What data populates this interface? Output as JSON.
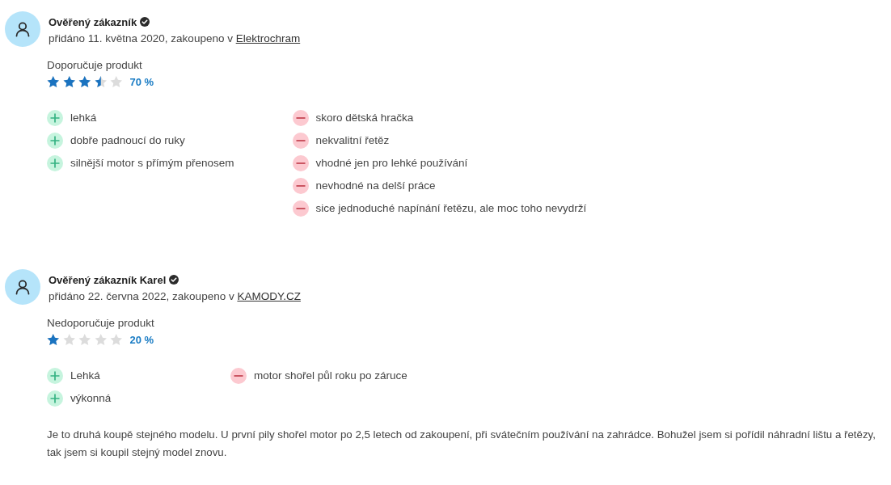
{
  "reviews": [
    {
      "author": "Ověřený zákazník",
      "verified": true,
      "purchase_info": "přidáno 11. května 2020, zakoupeno v",
      "shop": "Elektrochram",
      "recommendation": "Doporučuje produkt",
      "stars": 3.5,
      "rating": "70 %",
      "pros": [
        "lehká",
        "dobře padnoucí do ruky",
        "silnější motor s přímým přenosem"
      ],
      "cons": [
        "skoro dětská hračka",
        "nekvalitní řetěz",
        "vhodné jen pro lehké používání",
        "nevhodné na delší práce",
        "sice jednoduché napínání řetězu, ale moc toho nevydrží"
      ]
    },
    {
      "author": "Ověřený zákazník Karel",
      "verified": true,
      "purchase_info": "přidáno 22. června 2022, zakoupeno v",
      "shop": "KAMODY.CZ",
      "recommendation": "Nedoporučuje produkt",
      "stars": 1,
      "rating": "20 %",
      "pros": [
        "Lehká",
        "výkonná"
      ],
      "cons": [
        "motor shořel půl roku po záruce"
      ],
      "comment": "Je to druhá koupě stejného modelu. U první pily shořel motor po 2,5 letech od zakoupení, při svátečním používání na zahrádce. Bohužel jsem si pořídil náhradní lištu a řetězy, tak jsem si koupil stejný model znovu."
    }
  ]
}
